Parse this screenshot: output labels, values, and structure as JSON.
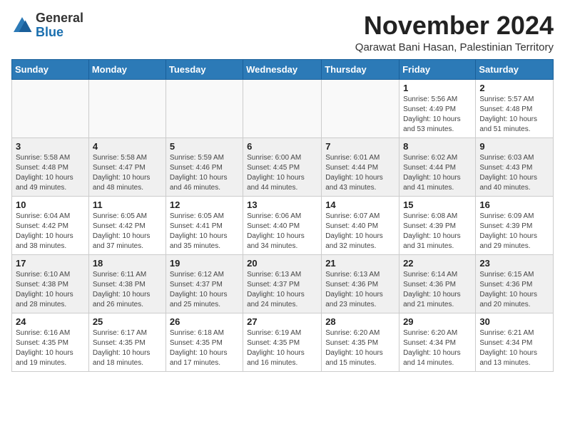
{
  "header": {
    "logo_general": "General",
    "logo_blue": "Blue",
    "month_title": "November 2024",
    "location": "Qarawat Bani Hasan, Palestinian Territory"
  },
  "days_of_week": [
    "Sunday",
    "Monday",
    "Tuesday",
    "Wednesday",
    "Thursday",
    "Friday",
    "Saturday"
  ],
  "weeks": [
    [
      {
        "day": "",
        "info": ""
      },
      {
        "day": "",
        "info": ""
      },
      {
        "day": "",
        "info": ""
      },
      {
        "day": "",
        "info": ""
      },
      {
        "day": "",
        "info": ""
      },
      {
        "day": "1",
        "info": "Sunrise: 5:56 AM\nSunset: 4:49 PM\nDaylight: 10 hours\nand 53 minutes."
      },
      {
        "day": "2",
        "info": "Sunrise: 5:57 AM\nSunset: 4:48 PM\nDaylight: 10 hours\nand 51 minutes."
      }
    ],
    [
      {
        "day": "3",
        "info": "Sunrise: 5:58 AM\nSunset: 4:48 PM\nDaylight: 10 hours\nand 49 minutes."
      },
      {
        "day": "4",
        "info": "Sunrise: 5:58 AM\nSunset: 4:47 PM\nDaylight: 10 hours\nand 48 minutes."
      },
      {
        "day": "5",
        "info": "Sunrise: 5:59 AM\nSunset: 4:46 PM\nDaylight: 10 hours\nand 46 minutes."
      },
      {
        "day": "6",
        "info": "Sunrise: 6:00 AM\nSunset: 4:45 PM\nDaylight: 10 hours\nand 44 minutes."
      },
      {
        "day": "7",
        "info": "Sunrise: 6:01 AM\nSunset: 4:44 PM\nDaylight: 10 hours\nand 43 minutes."
      },
      {
        "day": "8",
        "info": "Sunrise: 6:02 AM\nSunset: 4:44 PM\nDaylight: 10 hours\nand 41 minutes."
      },
      {
        "day": "9",
        "info": "Sunrise: 6:03 AM\nSunset: 4:43 PM\nDaylight: 10 hours\nand 40 minutes."
      }
    ],
    [
      {
        "day": "10",
        "info": "Sunrise: 6:04 AM\nSunset: 4:42 PM\nDaylight: 10 hours\nand 38 minutes."
      },
      {
        "day": "11",
        "info": "Sunrise: 6:05 AM\nSunset: 4:42 PM\nDaylight: 10 hours\nand 37 minutes."
      },
      {
        "day": "12",
        "info": "Sunrise: 6:05 AM\nSunset: 4:41 PM\nDaylight: 10 hours\nand 35 minutes."
      },
      {
        "day": "13",
        "info": "Sunrise: 6:06 AM\nSunset: 4:40 PM\nDaylight: 10 hours\nand 34 minutes."
      },
      {
        "day": "14",
        "info": "Sunrise: 6:07 AM\nSunset: 4:40 PM\nDaylight: 10 hours\nand 32 minutes."
      },
      {
        "day": "15",
        "info": "Sunrise: 6:08 AM\nSunset: 4:39 PM\nDaylight: 10 hours\nand 31 minutes."
      },
      {
        "day": "16",
        "info": "Sunrise: 6:09 AM\nSunset: 4:39 PM\nDaylight: 10 hours\nand 29 minutes."
      }
    ],
    [
      {
        "day": "17",
        "info": "Sunrise: 6:10 AM\nSunset: 4:38 PM\nDaylight: 10 hours\nand 28 minutes."
      },
      {
        "day": "18",
        "info": "Sunrise: 6:11 AM\nSunset: 4:38 PM\nDaylight: 10 hours\nand 26 minutes."
      },
      {
        "day": "19",
        "info": "Sunrise: 6:12 AM\nSunset: 4:37 PM\nDaylight: 10 hours\nand 25 minutes."
      },
      {
        "day": "20",
        "info": "Sunrise: 6:13 AM\nSunset: 4:37 PM\nDaylight: 10 hours\nand 24 minutes."
      },
      {
        "day": "21",
        "info": "Sunrise: 6:13 AM\nSunset: 4:36 PM\nDaylight: 10 hours\nand 23 minutes."
      },
      {
        "day": "22",
        "info": "Sunrise: 6:14 AM\nSunset: 4:36 PM\nDaylight: 10 hours\nand 21 minutes."
      },
      {
        "day": "23",
        "info": "Sunrise: 6:15 AM\nSunset: 4:36 PM\nDaylight: 10 hours\nand 20 minutes."
      }
    ],
    [
      {
        "day": "24",
        "info": "Sunrise: 6:16 AM\nSunset: 4:35 PM\nDaylight: 10 hours\nand 19 minutes."
      },
      {
        "day": "25",
        "info": "Sunrise: 6:17 AM\nSunset: 4:35 PM\nDaylight: 10 hours\nand 18 minutes."
      },
      {
        "day": "26",
        "info": "Sunrise: 6:18 AM\nSunset: 4:35 PM\nDaylight: 10 hours\nand 17 minutes."
      },
      {
        "day": "27",
        "info": "Sunrise: 6:19 AM\nSunset: 4:35 PM\nDaylight: 10 hours\nand 16 minutes."
      },
      {
        "day": "28",
        "info": "Sunrise: 6:20 AM\nSunset: 4:35 PM\nDaylight: 10 hours\nand 15 minutes."
      },
      {
        "day": "29",
        "info": "Sunrise: 6:20 AM\nSunset: 4:34 PM\nDaylight: 10 hours\nand 14 minutes."
      },
      {
        "day": "30",
        "info": "Sunrise: 6:21 AM\nSunset: 4:34 PM\nDaylight: 10 hours\nand 13 minutes."
      }
    ]
  ]
}
